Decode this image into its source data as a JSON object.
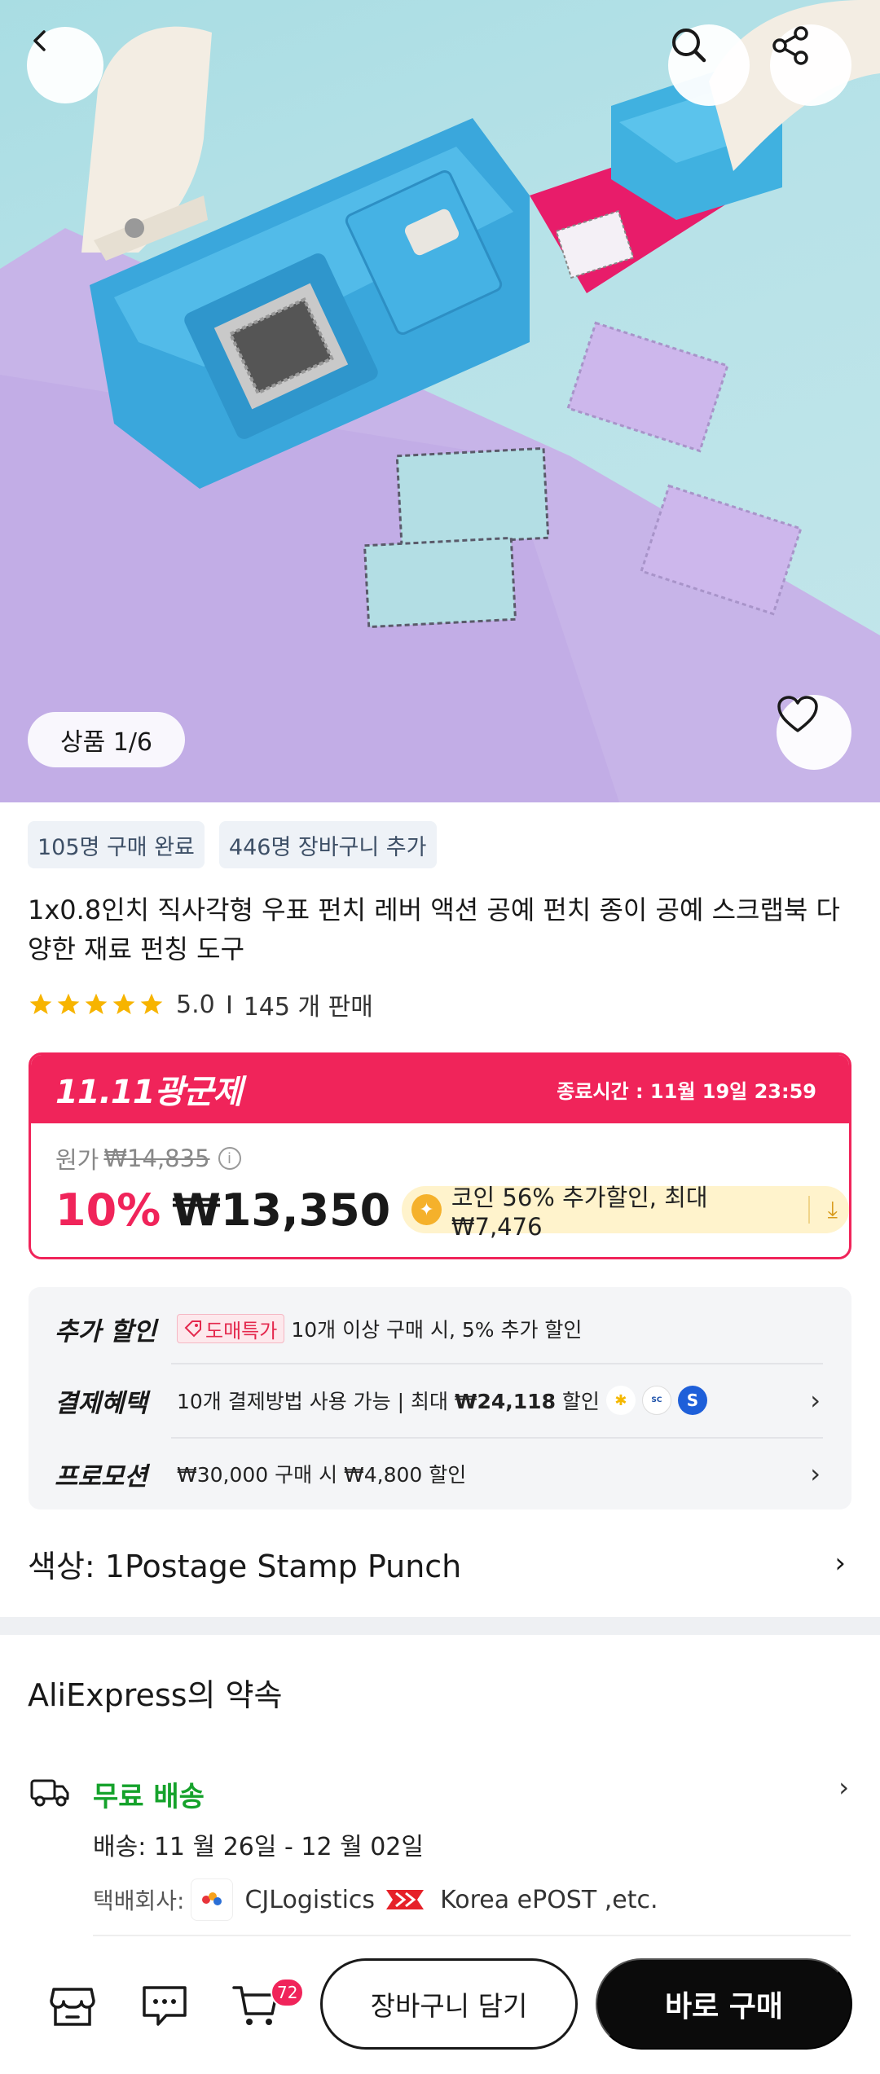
{
  "gallery": {
    "counter": "상품 1/6"
  },
  "tags": [
    "105명 구매 완료",
    "446명 장바구니 추가"
  ],
  "product": {
    "title": "1x0.8인치 직사각형 우표 펀치 레버 액션 공예 펀치 종이 공예 스크랩북 다양한 재료 펀칭 도구",
    "rating": "5.0",
    "stars": 5,
    "sold": "145 개 판매"
  },
  "promo": {
    "logo": "11.11광군제",
    "end_time": "종료시간 :  11월 19일 23:59",
    "original_label": "원가",
    "original_price": "₩14,835",
    "discount": "10%",
    "price": "₩13,350",
    "coin_text": "코인 56% 추가할인, 최대 ₩7,476",
    "accent_color": "#f0245a"
  },
  "benefits": {
    "extra_label": "추가 할인",
    "wholesale_badge": "도매특가",
    "extra_text": "10개 이상 구매 시, 5% 추가 할인",
    "payment_label": "결제혜택",
    "payment_text_1": "10개 결제방법 사용 가능 | 최대 ",
    "payment_amount": "₩24,118",
    "payment_text_2": " 할인",
    "promotion_label": "프로모션",
    "promotion_text": "₩30,000 구매 시 ₩4,800 할인"
  },
  "variant": {
    "text": "색상: 1Postage Stamp Punch"
  },
  "promise": {
    "title": "AliExpress의 약속",
    "free_shipping": "무료 배송",
    "delivery": "배송: 11 월 26일 - 12 월 02일",
    "carrier_label": "택배회사:",
    "carrier_1": "CJLogistics",
    "carrier_2": "Korea ePOST ,etc."
  },
  "bottom_bar": {
    "cart_count": "72",
    "add_to_cart": "장바구니 담기",
    "buy_now": "바로 구매"
  },
  "icons": [
    "back-icon",
    "search-icon",
    "share-icon",
    "heart-icon",
    "info-icon",
    "coin-icon",
    "download-icon",
    "tag-icon",
    "chevron-right-icon",
    "truck-icon",
    "store-icon",
    "chat-icon",
    "cart-icon"
  ]
}
